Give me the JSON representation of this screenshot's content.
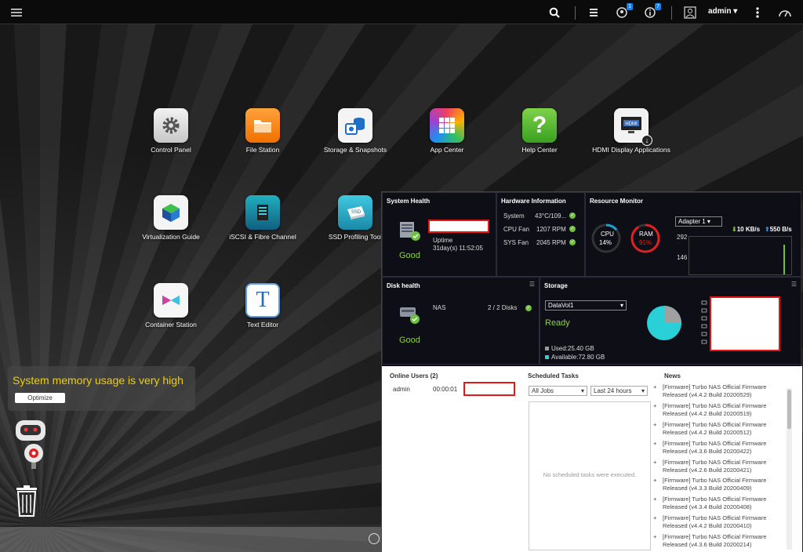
{
  "topbar": {
    "user": "admin",
    "notification_count": "1",
    "info_count": "7"
  },
  "apps": [
    {
      "label": "Control Panel",
      "icon": "gear-icon"
    },
    {
      "label": "File Station",
      "icon": "folder-icon"
    },
    {
      "label": "Storage & Snapshots",
      "icon": "storage-icon"
    },
    {
      "label": "App Center",
      "icon": "app-grid-icon"
    },
    {
      "label": "Help Center",
      "icon": "question-icon"
    },
    {
      "label": "HDMI Display Applications",
      "icon": "hdmi-icon"
    },
    {
      "label": "Virtualization Guide",
      "icon": "cube-icon"
    },
    {
      "label": "iSCSI & Fibre Channel",
      "icon": "server-icon"
    },
    {
      "label": "SSD Profiling Tool",
      "icon": "ssd-icon"
    },
    {
      "label": "Container Station",
      "icon": "container-icon"
    },
    {
      "label": "Text Editor",
      "icon": "text-icon"
    }
  ],
  "notification": {
    "message": "System memory usage is very high",
    "button": "Optimize"
  },
  "system_health": {
    "title": "System Health",
    "status": "Good",
    "uptime_label": "Uptime",
    "uptime_value": "31day(s) 11:52:05"
  },
  "hardware": {
    "title": "Hardware Information",
    "rows": [
      {
        "label": "System",
        "value": "43°C/109..."
      },
      {
        "label": "CPU Fan",
        "value": "1207 RPM"
      },
      {
        "label": "SYS Fan",
        "value": "2045 RPM"
      }
    ]
  },
  "resource": {
    "title": "Resource Monitor",
    "cpu_label": "CPU",
    "cpu_value": "14%",
    "cpu_fraction": 0.14,
    "ram_label": "RAM",
    "ram_value": "91%",
    "ram_fraction": 0.91,
    "adapter": "Adapter 1",
    "down_speed": "10 KB/s",
    "up_speed": "550 B/s",
    "y_top": "292",
    "y_mid": "146"
  },
  "disk": {
    "title": "Disk health",
    "name": "NAS",
    "count": "2 / 2 Disks",
    "status": "Good"
  },
  "storage": {
    "title": "Storage",
    "volume": "DataVol1",
    "status": "Ready",
    "used": "Used:25.40 GB",
    "available": "Available:72.80 GB"
  },
  "online_users": {
    "title": "Online Users (2)",
    "user": "admin",
    "time": "00:00:01"
  },
  "scheduled": {
    "title": "Scheduled Tasks",
    "filter1": "All Jobs",
    "filter2": "Last 24 hours",
    "empty": "No scheduled tasks were executed."
  },
  "news": {
    "title": "News",
    "items": [
      "[Firmware] Turbo NAS Official Firmware Released (v4.4.2 Build 20200529)",
      "[Firmware] Turbo NAS Official Firmware Released (v4.4.2 Build 20200519)",
      "[Firmware] Turbo NAS Official Firmware Released (v4.4.2 Build 20200512)",
      "[Firmware] Turbo NAS Official Firmware Released (v4.3.6 Build 20200422)",
      "[Firmware] Turbo NAS Official Firmware Released (v4.2.6 Build 20200421)",
      "[Firmware] Turbo NAS Official Firmware Released (v4.3.3 Build 20200409)",
      "[Firmware] Turbo NAS Official Firmware Released (v4.3.4 Build 20200408)",
      "[Firmware] Turbo NAS Official Firmware Released (v4.4.2 Build 20200410)",
      "[Firmware] Turbo NAS Official Firmware Released (v4.3.6 Build 20200214)"
    ]
  },
  "colors": {
    "accent": "#1e7ee8",
    "good": "#8fd04a",
    "warning": "#f0d000",
    "cpu_ring": "#1e9ec8",
    "ram_ring": "#e02020"
  }
}
